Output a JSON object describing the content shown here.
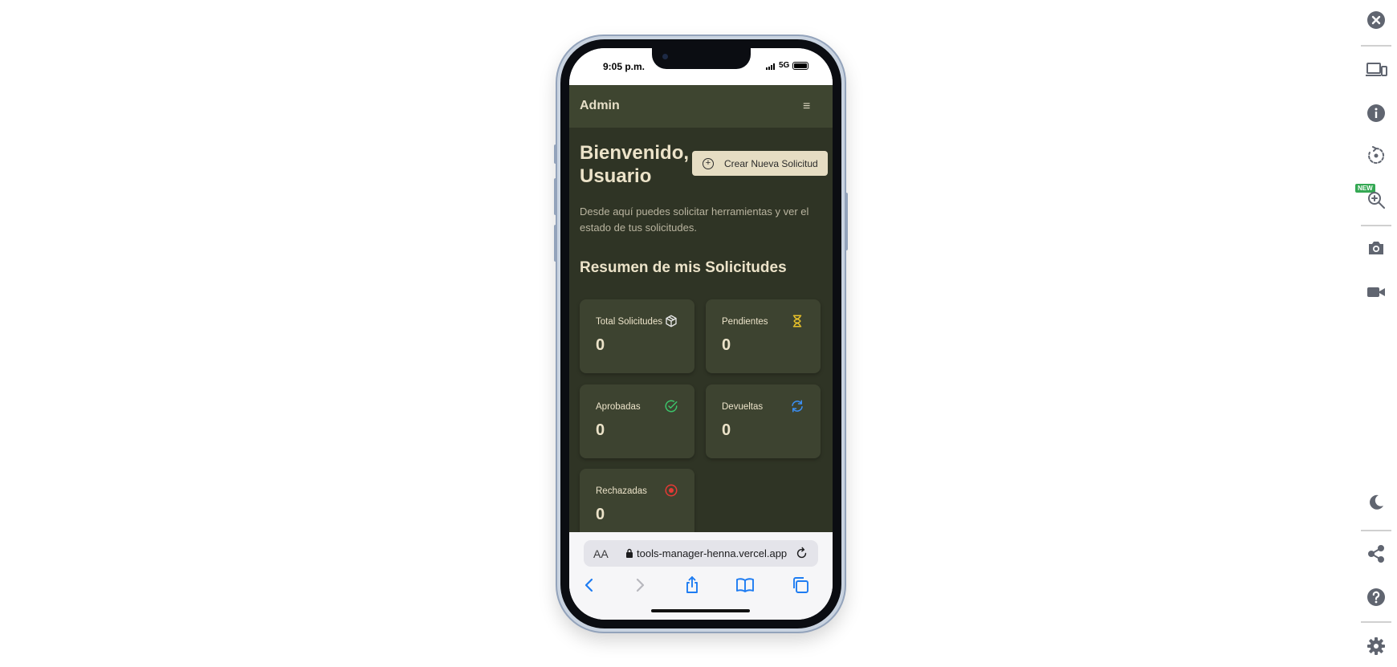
{
  "status_bar": {
    "time": "9:05 p.m.",
    "network": "5G"
  },
  "app": {
    "brand": "Admin",
    "menu_icon": "hamburger-icon",
    "welcome_title": "Bienvenido, Usuario",
    "new_request_button": "Crear Nueva Solicitud",
    "intro_text": "Desde aquí puedes solicitar herramientas y ver el estado de tus solicitudes.",
    "summary_title": "Resumen de mis Solicitudes",
    "cards": [
      {
        "label": "Total Solicitudes",
        "value": "0",
        "icon": "box-icon",
        "color": "#e6e6e6"
      },
      {
        "label": "Pendientes",
        "value": "0",
        "icon": "hourglass-icon",
        "color": "#e8c12a"
      },
      {
        "label": "Aprobadas",
        "value": "0",
        "icon": "check-circle-icon",
        "color": "#3cc36a"
      },
      {
        "label": "Devueltas",
        "value": "0",
        "icon": "refresh-icon",
        "color": "#3b8ff5"
      },
      {
        "label": "Rechazadas",
        "value": "0",
        "icon": "x-circle-icon",
        "color": "#e53935"
      }
    ]
  },
  "browser": {
    "text_size_label": "AA",
    "url": "tools-manager-henna.vercel.app",
    "nav_icons": [
      "back-icon",
      "forward-icon",
      "share-icon",
      "bookmarks-icon",
      "tabs-icon"
    ]
  },
  "toolbar": {
    "items": [
      "close-icon",
      "devices-icon",
      "info-icon",
      "rotate-icon",
      "zoom-icon",
      "camera-icon",
      "video-icon",
      "dark-mode-icon",
      "share-icon",
      "help-icon",
      "settings-icon"
    ],
    "new_badge": "NEW"
  },
  "colors": {
    "app_bg": "#2f3425",
    "header_bg": "#3e4530",
    "card_bg": "#3d4330",
    "accent_button": "#e6ddc3",
    "text_light": "#ece3c9"
  }
}
